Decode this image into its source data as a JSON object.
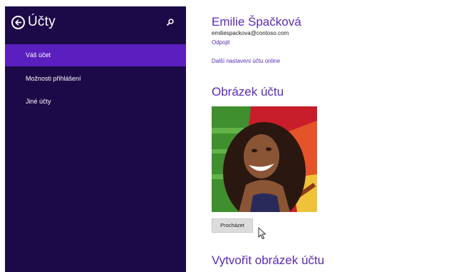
{
  "sidebar": {
    "title": "Účty",
    "items": [
      {
        "label": "Váš účet",
        "selected": true
      },
      {
        "label": "Možnosti přihlášení",
        "selected": false
      },
      {
        "label": "Jiné účty",
        "selected": false
      }
    ]
  },
  "account": {
    "name": "Emilie Špačková",
    "email": "emiliespackova@contoso.com",
    "disconnect_link": "Odpojit",
    "online_settings_link": "Další nastavení účtu online"
  },
  "picture_section": {
    "title": "Obrázek účtu",
    "browse_label": "Procházet"
  },
  "create_section": {
    "title": "Vytvořit obrázek účtu"
  },
  "icons": {
    "back": "back-arrow-icon",
    "search": "search-icon",
    "cursor": "mouse-pointer-icon"
  },
  "colors": {
    "sidebar_bg": "#1c0a48",
    "selected_bg": "#5b1fbf",
    "accent": "#5b2ab8"
  }
}
